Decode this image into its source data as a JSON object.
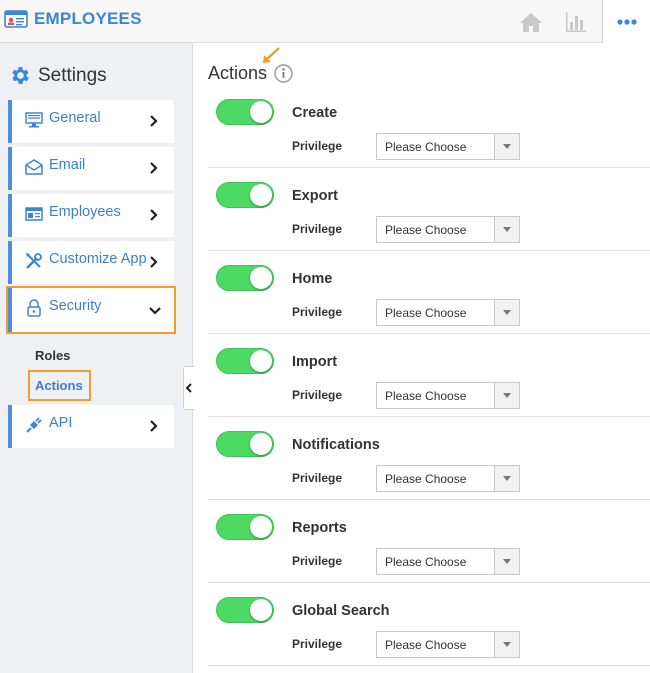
{
  "app": {
    "title": "EMPLOYEES"
  },
  "sidebar": {
    "title": "Settings",
    "items": [
      {
        "label": "General",
        "icon": "monitor-icon"
      },
      {
        "label": "Email",
        "icon": "envelope-icon"
      },
      {
        "label": "Employees",
        "icon": "id-card-icon"
      },
      {
        "label": "Customize App",
        "icon": "tools-icon"
      },
      {
        "label": "Security",
        "icon": "lock-icon",
        "expanded": true
      },
      {
        "label": "API",
        "icon": "plug-icon"
      }
    ],
    "subitems": [
      {
        "label": "Roles"
      },
      {
        "label": "Actions",
        "active": true
      }
    ]
  },
  "main": {
    "title": "Actions",
    "privilege_label": "Privilege",
    "select_placeholder": "Please Choose",
    "actions": [
      {
        "name": "Create",
        "enabled": true
      },
      {
        "name": "Export",
        "enabled": true
      },
      {
        "name": "Home",
        "enabled": true
      },
      {
        "name": "Import",
        "enabled": true
      },
      {
        "name": "Notifications",
        "enabled": true
      },
      {
        "name": "Reports",
        "enabled": true
      },
      {
        "name": "Global Search",
        "enabled": true
      }
    ]
  },
  "colors": {
    "accent": "#3a86d8",
    "highlight": "#f39c2a",
    "toggle_on": "#4cd964"
  }
}
